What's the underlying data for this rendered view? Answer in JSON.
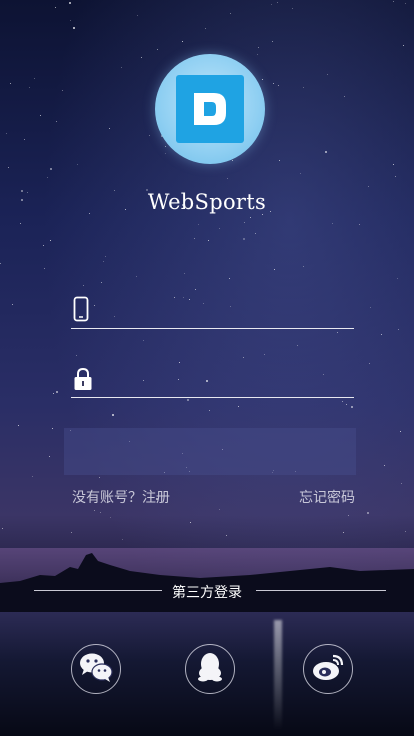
{
  "app": {
    "name": "WebSports"
  },
  "login": {
    "phone_placeholder": "",
    "password_placeholder": "",
    "login_button_label": ""
  },
  "links": {
    "register": "没有账号？注册",
    "forgot_password": "忘记密码"
  },
  "third_party": {
    "title": "第三方登录",
    "providers": [
      "wechat",
      "qq",
      "weibo"
    ]
  },
  "colors": {
    "logo_blue": "#1fa3e3",
    "logo_ring": "#8fcff2"
  }
}
